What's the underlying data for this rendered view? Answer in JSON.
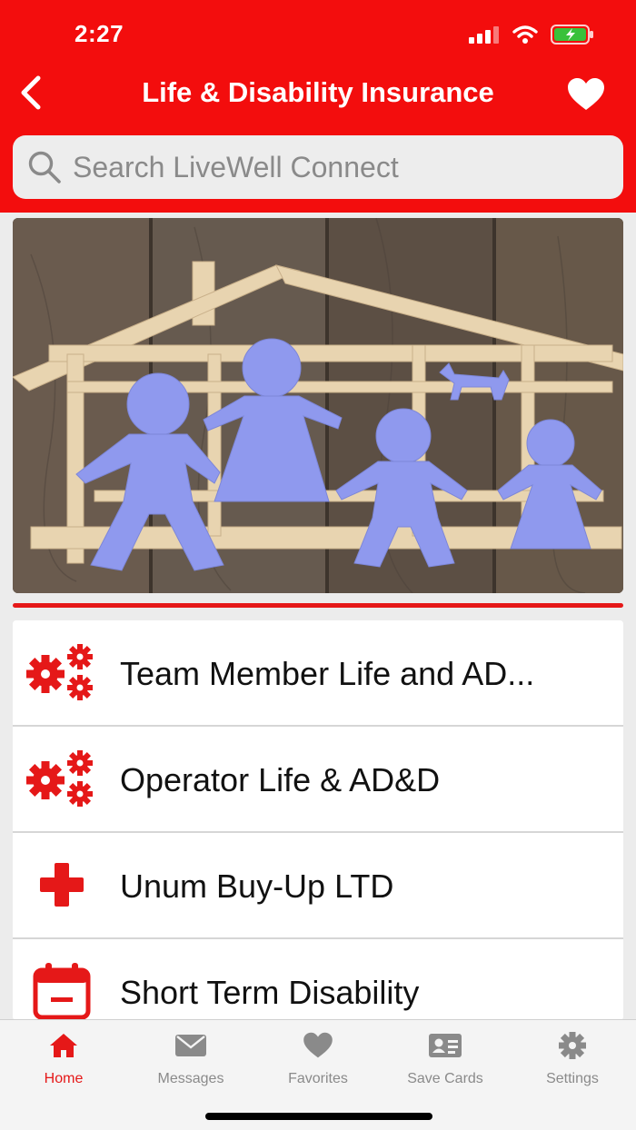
{
  "status": {
    "time": "2:27"
  },
  "nav": {
    "title": "Life & Disability Insurance",
    "back_icon": "chevron-left-icon",
    "favorite_icon": "heart-icon"
  },
  "search": {
    "placeholder": "Search LiveWell Connect",
    "value": ""
  },
  "hero": {
    "image": "paper-cutout-family-in-house-frame"
  },
  "colors": {
    "brand": "#f30d0d",
    "accent": "#e51818",
    "tab_inactive": "#8a8a8a"
  },
  "list": {
    "items": [
      {
        "label": "Team Member Life and AD...",
        "icon": "gears-icon"
      },
      {
        "label": "Operator Life & AD&D",
        "icon": "gears-icon"
      },
      {
        "label": "Unum Buy-Up LTD",
        "icon": "medical-cross-icon"
      },
      {
        "label": "Short Term Disability",
        "icon": "calendar-icon"
      }
    ]
  },
  "tabs": [
    {
      "label": "Home",
      "icon": "home-icon",
      "active": true
    },
    {
      "label": "Messages",
      "icon": "envelope-icon",
      "active": false
    },
    {
      "label": "Favorites",
      "icon": "heart-icon",
      "active": false
    },
    {
      "label": "Save Cards",
      "icon": "id-card-icon",
      "active": false
    },
    {
      "label": "Settings",
      "icon": "gear-icon",
      "active": false
    }
  ]
}
